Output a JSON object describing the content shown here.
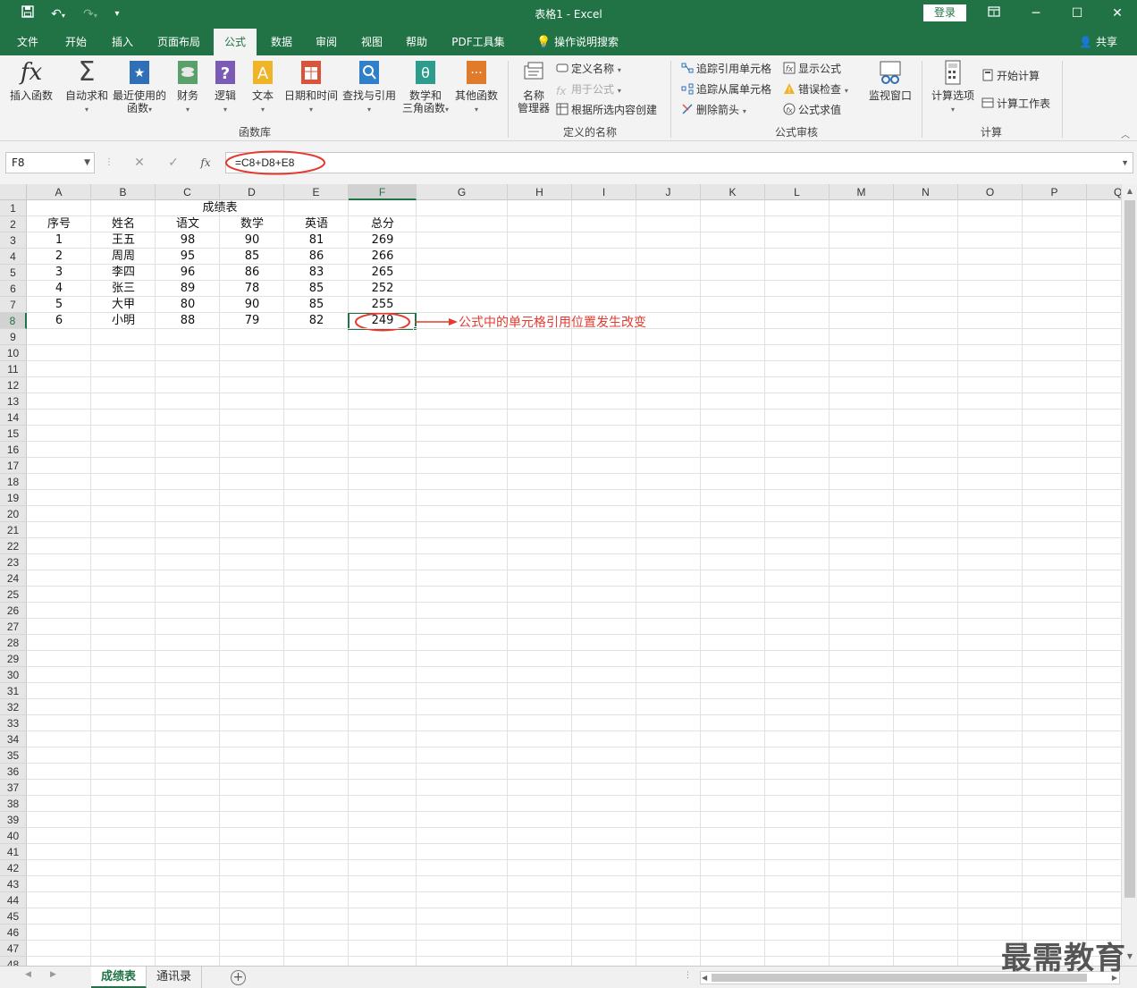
{
  "window": {
    "title": "表格1  -  Excel",
    "login": "登录"
  },
  "tabs": [
    {
      "label": "文件"
    },
    {
      "label": "开始"
    },
    {
      "label": "插入"
    },
    {
      "label": "页面布局"
    },
    {
      "label": "公式"
    },
    {
      "label": "数据"
    },
    {
      "label": "审阅"
    },
    {
      "label": "视图"
    },
    {
      "label": "帮助"
    },
    {
      "label": "PDF工具集"
    },
    {
      "label": "操作说明搜索"
    }
  ],
  "share": "共享",
  "ribbon": {
    "function_library": {
      "label": "函数库",
      "insert_function": "插入函数",
      "autosum": "自动求和",
      "recent_line1": "最近使用的",
      "recent_line2": "函数",
      "financial": "财务",
      "logical": "逻辑",
      "text": "文本",
      "datetime": "日期和时间",
      "lookup": "查找与引用",
      "math_line1": "数学和",
      "math_line2": "三角函数",
      "more": "其他函数"
    },
    "defined_names": {
      "label": "定义的名称",
      "name_manager_line1": "名称",
      "name_manager_line2": "管理器",
      "define_name": "定义名称",
      "use_in_formula": "用于公式",
      "create_from_selection": "根据所选内容创建"
    },
    "formula_auditing": {
      "label": "公式审核",
      "trace_precedents": "追踪引用单元格",
      "trace_dependents": "追踪从属单元格",
      "remove_arrows": "删除箭头",
      "show_formulas": "显示公式",
      "error_checking": "错误检查",
      "evaluate_formula": "公式求值",
      "watch_window": "监视窗口"
    },
    "calculation": {
      "label": "计算",
      "options": "计算选项",
      "calc_now": "开始计算",
      "calc_sheet": "计算工作表"
    }
  },
  "formula_bar": {
    "name_box": "F8",
    "formula": "=C8+D8+E8"
  },
  "columns": [
    "A",
    "B",
    "C",
    "D",
    "E",
    "F",
    "G",
    "H",
    "I",
    "J",
    "K",
    "L",
    "M",
    "N",
    "O",
    "P",
    "Q"
  ],
  "sheet": {
    "title": "成绩表",
    "headers": [
      "序号",
      "姓名",
      "语文",
      "数学",
      "英语",
      "总分"
    ],
    "rows": [
      [
        "1",
        "王五",
        "98",
        "90",
        "81",
        "269"
      ],
      [
        "2",
        "周周",
        "95",
        "85",
        "86",
        "266"
      ],
      [
        "3",
        "李四",
        "96",
        "86",
        "83",
        "265"
      ],
      [
        "4",
        "张三",
        "89",
        "78",
        "85",
        "252"
      ],
      [
        "5",
        "大甲",
        "80",
        "90",
        "85",
        "255"
      ],
      [
        "6",
        "小明",
        "88",
        "79",
        "82",
        "249"
      ]
    ]
  },
  "annotation": "公式中的单元格引用位置发生改变",
  "sheet_tabs": [
    {
      "label": "成绩表",
      "active": true
    },
    {
      "label": "通讯录",
      "active": false
    }
  ],
  "watermark": "最需教育",
  "colors": {
    "brand": "#217346",
    "annotation": "#e53a2f"
  }
}
